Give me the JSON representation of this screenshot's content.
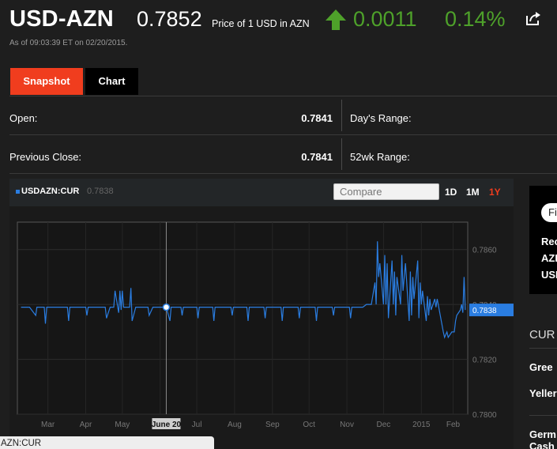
{
  "header": {
    "ticker": "USD-AZN",
    "price": "0.7852",
    "price_description": "Price of 1 USD in AZN",
    "change": "0.0011",
    "change_percent": "0.14%",
    "direction_icon": "up-arrow-icon",
    "share_icon": "share-icon",
    "as_of": "As of 09:03:39 ET on 02/20/2015.",
    "positive_color": "#4ea12a"
  },
  "tabs": [
    {
      "label": "Snapshot",
      "active": true
    },
    {
      "label": "Chart",
      "active": false
    }
  ],
  "stats": {
    "open_label": "Open:",
    "open_value": "0.7841",
    "days_range_label": "Day's Range:",
    "prev_close_label": "Previous Close:",
    "prev_close_value": "0.7841",
    "wk52_range_label": "52wk Range:"
  },
  "chart_toolbar": {
    "symbol": "USDAZN:CUR",
    "last_value": "0.7838",
    "compare_placeholder": "Compare",
    "ranges": [
      "1D",
      "1M",
      "1Y"
    ],
    "selected_range": "1Y",
    "accent_color": "#f03d1e",
    "series_color": "#2a7de1"
  },
  "chart_data": {
    "type": "line",
    "title": "",
    "xlabel": "",
    "ylabel": "",
    "x_tick_labels": [
      "Mar",
      "Apr",
      "May",
      "Jun",
      "Jul",
      "Aug",
      "Sep",
      "Oct",
      "Nov",
      "Dec",
      "2015",
      "Feb"
    ],
    "y_ticks": [
      "0.7860",
      "0.7840",
      "0.7820",
      "0.7800"
    ],
    "ylim": [
      0.78,
      0.787
    ],
    "grid": true,
    "crosshair_label": "June 20",
    "current_value_label": "0.7838",
    "series": [
      {
        "name": "USDAZN:CUR",
        "x": [
          0,
          2,
          4,
          5,
          6,
          8,
          9,
          10,
          11,
          12,
          14,
          16,
          17,
          18,
          19,
          20,
          22,
          24,
          26,
          28,
          30,
          31,
          32,
          33,
          34,
          35,
          36,
          37,
          38,
          39,
          40,
          41,
          42,
          43,
          44,
          45,
          46,
          47,
          48,
          49,
          50,
          51,
          52,
          53,
          54,
          55,
          56,
          58,
          59,
          60,
          61,
          62,
          63,
          64,
          65,
          66,
          68,
          69,
          70,
          71,
          72,
          73,
          74,
          75,
          76,
          77,
          78,
          79,
          80,
          81,
          82,
          83,
          84,
          85,
          86,
          87,
          88,
          89,
          90,
          91,
          92,
          93,
          94,
          95,
          96,
          97,
          98,
          99,
          100
        ],
        "values": [
          0.7839,
          0.7839,
          0.7836,
          0.7839,
          0.7839,
          0.7833,
          0.7839,
          0.7839,
          0.7836,
          0.7839,
          0.7839,
          0.7835,
          0.7839,
          0.7839,
          0.7845,
          0.7839,
          0.7839,
          0.7836,
          0.7839,
          0.7839,
          0.7839,
          0.7833,
          0.7839,
          0.7836,
          0.7839,
          0.7839,
          0.7839,
          0.7839,
          0.7839,
          0.7836,
          0.7839,
          0.7839,
          0.7834,
          0.7839,
          0.7839,
          0.7839,
          0.7836,
          0.7839,
          0.7839,
          0.7834,
          0.7839,
          0.7839,
          0.7836,
          0.7839,
          0.7839,
          0.7839,
          0.7839,
          0.7839,
          0.7839,
          0.7839,
          0.7839,
          0.7835,
          0.7839,
          0.7839,
          0.7839,
          0.7839,
          0.7839,
          0.7839,
          0.7839,
          0.7839,
          0.7839,
          0.7839,
          0.7839,
          0.7839,
          0.7839,
          0.7839,
          0.7839,
          0.7839,
          0.7839,
          0.7839,
          0.7839,
          0.7839,
          0.7839,
          0.7839,
          0.7839,
          0.7839,
          0.7839,
          0.7839,
          0.7839,
          0.7839,
          0.7839,
          0.7839,
          0.7839,
          0.7839,
          0.7839,
          0.7839,
          0.7839,
          0.7839,
          0.7839
        ],
        "points": [
          [
            "2014-02-21",
            0.7839
          ],
          [
            "2014-02-28",
            0.7839
          ],
          [
            "2014-03-05",
            0.7836
          ],
          [
            "2014-03-06",
            0.7839
          ],
          [
            "2014-03-12",
            0.7839
          ],
          [
            "2014-03-13",
            0.7833
          ],
          [
            "2014-03-14",
            0.7839
          ],
          [
            "2014-03-31",
            0.7839
          ],
          [
            "2014-04-01",
            0.7834
          ],
          [
            "2014-04-02",
            0.7839
          ],
          [
            "2014-04-15",
            0.7839
          ],
          [
            "2014-04-16",
            0.7836
          ],
          [
            "2014-04-17",
            0.7839
          ],
          [
            "2014-05-01",
            0.7839
          ],
          [
            "2014-05-02",
            0.7835
          ],
          [
            "2014-05-05",
            0.7839
          ],
          [
            "2014-05-08",
            0.7839
          ],
          [
            "2014-05-09",
            0.7845
          ],
          [
            "2014-05-12",
            0.7837
          ],
          [
            "2014-05-13",
            0.7845
          ],
          [
            "2014-05-14",
            0.7838
          ],
          [
            "2014-05-15",
            0.7845
          ],
          [
            "2014-05-16",
            0.7839
          ],
          [
            "2014-05-21",
            0.7839
          ],
          [
            "2014-05-22",
            0.7846
          ],
          [
            "2014-05-23",
            0.7834
          ],
          [
            "2014-05-26",
            0.7839
          ],
          [
            "2014-06-05",
            0.7839
          ],
          [
            "2014-06-06",
            0.7836
          ],
          [
            "2014-06-09",
            0.7839
          ],
          [
            "2014-06-20",
            0.7839
          ],
          [
            "2014-06-23",
            0.7834
          ],
          [
            "2014-06-24",
            0.7839
          ],
          [
            "2014-07-02",
            0.7839
          ],
          [
            "2014-07-03",
            0.7836
          ],
          [
            "2014-07-04",
            0.7839
          ],
          [
            "2014-07-15",
            0.7839
          ],
          [
            "2014-07-16",
            0.7835
          ],
          [
            "2014-07-17",
            0.7839
          ],
          [
            "2014-07-28",
            0.7839
          ],
          [
            "2014-07-29",
            0.7834
          ],
          [
            "2014-07-30",
            0.7839
          ],
          [
            "2014-08-12",
            0.7839
          ],
          [
            "2014-08-13",
            0.7836
          ],
          [
            "2014-08-14",
            0.7839
          ],
          [
            "2014-08-25",
            0.7839
          ],
          [
            "2014-08-26",
            0.7834
          ],
          [
            "2014-08-27",
            0.7839
          ],
          [
            "2014-09-08",
            0.7839
          ],
          [
            "2014-09-09",
            0.7835
          ],
          [
            "2014-09-10",
            0.7839
          ],
          [
            "2014-09-22",
            0.7839
          ],
          [
            "2014-09-23",
            0.7834
          ],
          [
            "2014-09-24",
            0.7839
          ],
          [
            "2014-10-06",
            0.7839
          ],
          [
            "2014-10-07",
            0.7835
          ],
          [
            "2014-10-08",
            0.7839
          ],
          [
            "2014-10-20",
            0.7839
          ],
          [
            "2014-10-21",
            0.7834
          ],
          [
            "2014-10-22",
            0.7839
          ],
          [
            "2014-11-03",
            0.7839
          ],
          [
            "2014-11-04",
            0.7836
          ],
          [
            "2014-11-05",
            0.7839
          ],
          [
            "2014-11-17",
            0.7839
          ],
          [
            "2014-11-18",
            0.7835
          ],
          [
            "2014-11-19",
            0.7839
          ],
          [
            "2014-11-28",
            0.7839
          ],
          [
            "2014-12-01",
            0.784
          ],
          [
            "2014-12-05",
            0.784
          ],
          [
            "2014-12-08",
            0.7848
          ],
          [
            "2014-12-09",
            0.784
          ],
          [
            "2014-12-10",
            0.7863
          ],
          [
            "2014-12-11",
            0.785
          ],
          [
            "2014-12-12",
            0.7855
          ],
          [
            "2014-12-15",
            0.784
          ],
          [
            "2014-12-16",
            0.7858
          ],
          [
            "2014-12-17",
            0.784
          ],
          [
            "2014-12-18",
            0.7855
          ],
          [
            "2014-12-19",
            0.7835
          ],
          [
            "2014-12-22",
            0.7856
          ],
          [
            "2014-12-23",
            0.784
          ],
          [
            "2014-12-24",
            0.7852
          ],
          [
            "2014-12-25",
            0.7836
          ],
          [
            "2014-12-26",
            0.785
          ],
          [
            "2014-12-29",
            0.784
          ],
          [
            "2014-12-30",
            0.7858
          ],
          [
            "2014-12-31",
            0.7845
          ],
          [
            "2015-01-02",
            0.7855
          ],
          [
            "2015-01-05",
            0.7834
          ],
          [
            "2015-01-06",
            0.7852
          ],
          [
            "2015-01-07",
            0.7836
          ],
          [
            "2015-01-08",
            0.785
          ],
          [
            "2015-01-09",
            0.7842
          ],
          [
            "2015-01-12",
            0.7856
          ],
          [
            "2015-01-13",
            0.7835
          ],
          [
            "2015-01-14",
            0.7848
          ],
          [
            "2015-01-15",
            0.784
          ],
          [
            "2015-01-16",
            0.7845
          ],
          [
            "2015-01-19",
            0.7834
          ],
          [
            "2015-01-20",
            0.7843
          ],
          [
            "2015-01-21",
            0.7836
          ],
          [
            "2015-01-22",
            0.7842
          ],
          [
            "2015-01-23",
            0.7838
          ],
          [
            "2015-01-26",
            0.7842
          ],
          [
            "2015-01-27",
            0.7839
          ],
          [
            "2015-01-28",
            0.7842
          ],
          [
            "2015-02-02",
            0.783
          ],
          [
            "2015-02-03",
            0.7828
          ],
          [
            "2015-02-04",
            0.7829
          ],
          [
            "2015-02-05",
            0.783
          ],
          [
            "2015-02-06",
            0.7828
          ],
          [
            "2015-02-09",
            0.783
          ],
          [
            "2015-02-10",
            0.783
          ],
          [
            "2015-02-11",
            0.783
          ],
          [
            "2015-02-12",
            0.7834
          ],
          [
            "2015-02-13",
            0.7836
          ],
          [
            "2015-02-16",
            0.7838
          ],
          [
            "2015-02-17",
            0.784
          ],
          [
            "2015-02-18",
            0.7837
          ],
          [
            "2015-02-19",
            0.785
          ],
          [
            "2015-02-20",
            0.7838
          ]
        ]
      }
    ]
  },
  "sidebar": {
    "pill_label": "Fi",
    "rec_lines": [
      "Rec",
      "AZI",
      "USI"
    ],
    "section_label": "CUR",
    "items": [
      "Gree",
      "Yeller",
      "Germ",
      "Cash"
    ]
  },
  "status_bar": {
    "text": "AZN:CUR"
  }
}
